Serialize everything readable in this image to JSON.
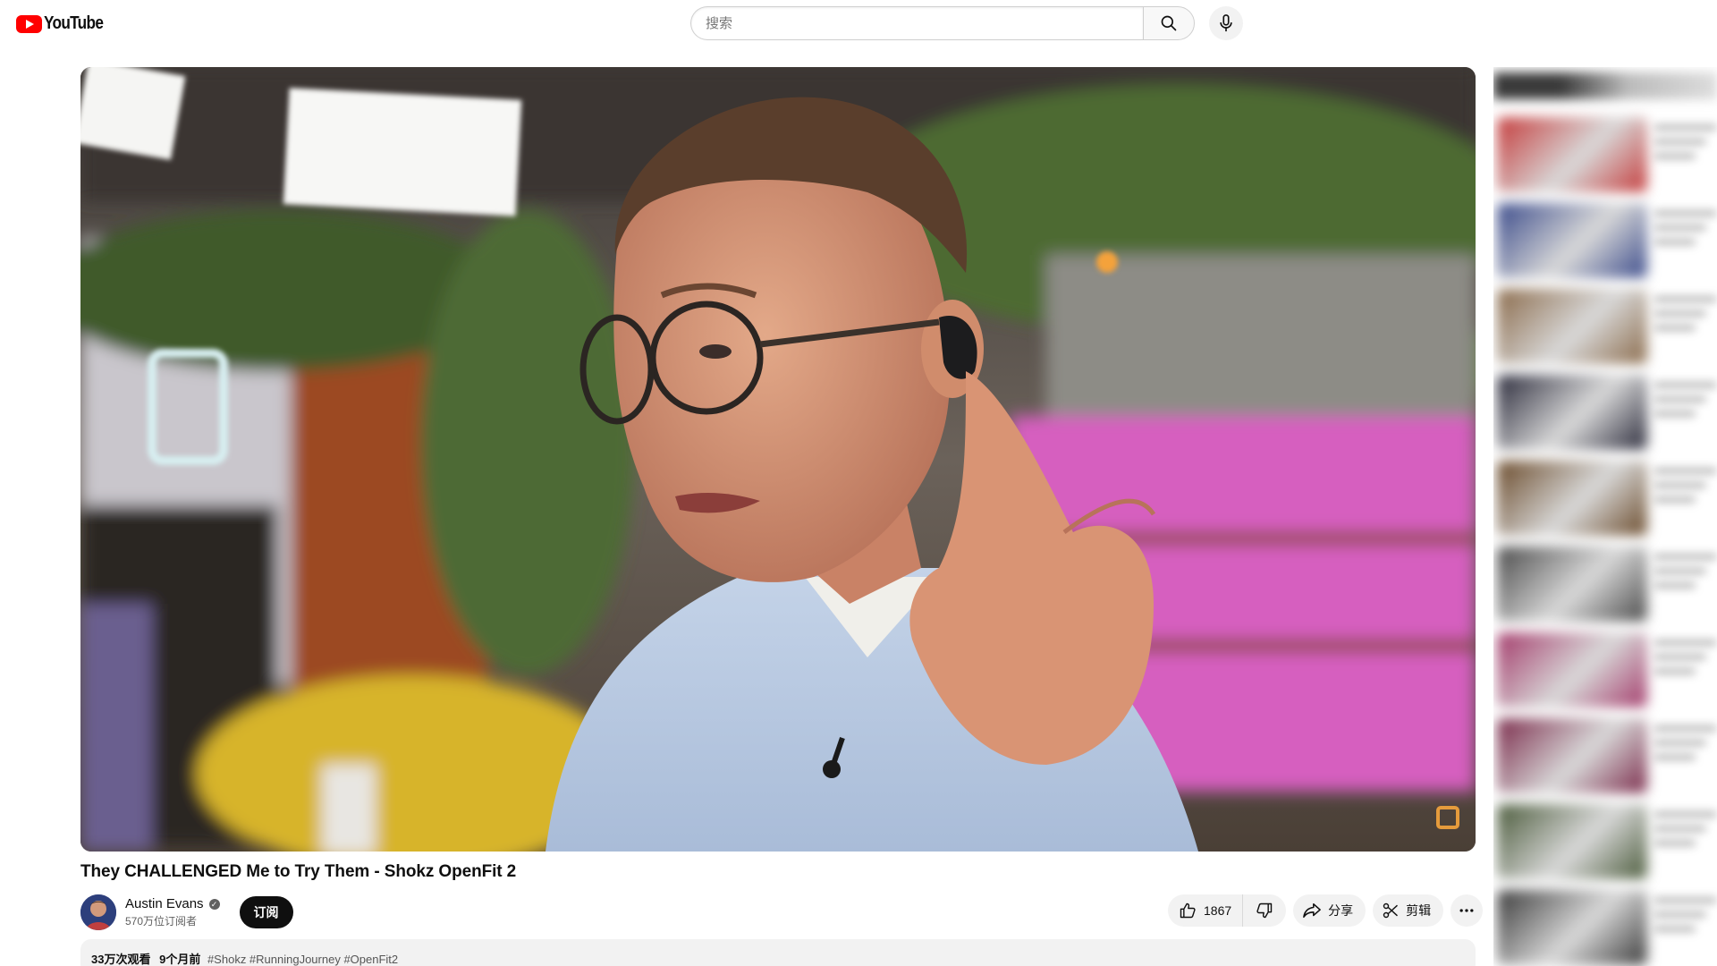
{
  "header": {
    "logo_text": "YouTube",
    "search_placeholder": "搜索",
    "icons": [
      "search-icon",
      "mic-icon"
    ]
  },
  "video": {
    "title": "They CHALLENGED Me to Try Them - Shokz OpenFit 2"
  },
  "channel": {
    "name": "Austin Evans",
    "subscribers": "570万位订阅者",
    "subscribe_label": "订阅"
  },
  "actions": {
    "like_count": "1867",
    "share_label": "分享",
    "clip_label": "剪辑"
  },
  "description": {
    "views": "33万次观看",
    "date": "9个月前",
    "hashtags": "#Shokz #RunningJourney #OpenFit2"
  },
  "colors": {
    "brand": "#ff0000",
    "subscribe_bg": "#0f0f0f",
    "pill_bg": "#f2f2f2"
  }
}
